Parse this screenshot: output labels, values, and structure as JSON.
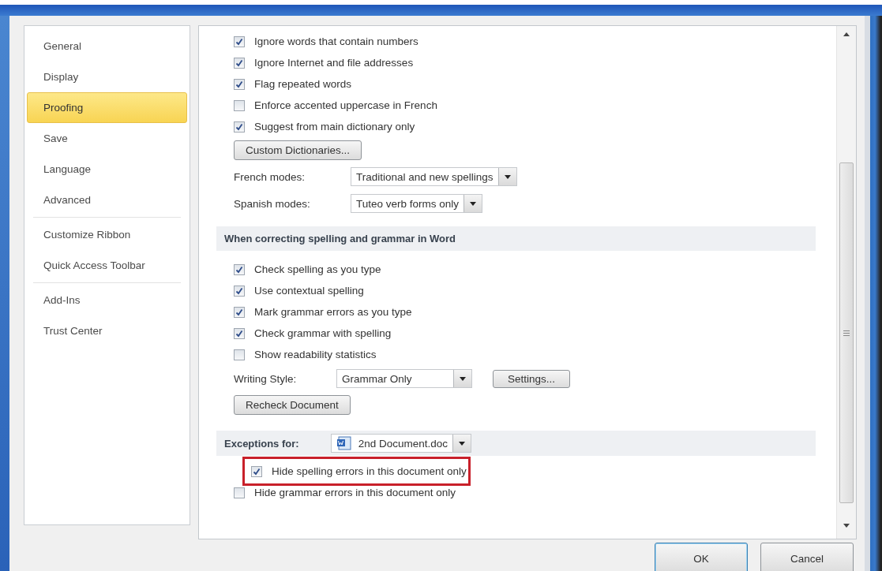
{
  "sidebar": {
    "items": [
      {
        "label": "General",
        "selected": false,
        "divider_after": false
      },
      {
        "label": "Display",
        "selected": false,
        "divider_after": false
      },
      {
        "label": "Proofing",
        "selected": true,
        "divider_after": false
      },
      {
        "label": "Save",
        "selected": false,
        "divider_after": false
      },
      {
        "label": "Language",
        "selected": false,
        "divider_after": false
      },
      {
        "label": "Advanced",
        "selected": false,
        "divider_after": true
      },
      {
        "label": "Customize Ribbon",
        "selected": false,
        "divider_after": false
      },
      {
        "label": "Quick Access Toolbar",
        "selected": false,
        "divider_after": true
      },
      {
        "label": "Add-Ins",
        "selected": false,
        "divider_after": false
      },
      {
        "label": "Trust Center",
        "selected": false,
        "divider_after": false
      }
    ]
  },
  "sections": [
    {
      "items": [
        {
          "kind": "checkbox",
          "label": "Ignore words that contain numbers",
          "checked": true,
          "highlighted": false
        },
        {
          "kind": "checkbox",
          "label": "Ignore Internet and file addresses",
          "checked": true,
          "highlighted": false
        },
        {
          "kind": "checkbox",
          "label": "Flag repeated words",
          "checked": true,
          "highlighted": false
        },
        {
          "kind": "checkbox",
          "label": "Enforce accented uppercase in French",
          "checked": false,
          "highlighted": false
        },
        {
          "kind": "checkbox",
          "label": "Suggest from main dictionary only",
          "checked": true,
          "highlighted": false
        },
        {
          "kind": "button",
          "label": "Custom Dictionaries..."
        },
        {
          "kind": "select",
          "label": "French modes:",
          "value": "Traditional and new spellings"
        },
        {
          "kind": "select",
          "label": "Spanish modes:",
          "value": "Tuteo verb forms only"
        }
      ]
    },
    {
      "header": {
        "kind": "title",
        "text": "When correcting spelling and grammar in Word"
      },
      "items": [
        {
          "kind": "checkbox",
          "label": "Check spelling as you type",
          "checked": true,
          "highlighted": false
        },
        {
          "kind": "checkbox",
          "label": "Use contextual spelling",
          "checked": true,
          "highlighted": false
        },
        {
          "kind": "checkbox",
          "label": "Mark grammar errors as you type",
          "checked": true,
          "highlighted": false
        },
        {
          "kind": "checkbox",
          "label": "Check grammar with spelling",
          "checked": true,
          "highlighted": false
        },
        {
          "kind": "checkbox",
          "label": "Show readability statistics",
          "checked": false,
          "highlighted": false
        },
        {
          "kind": "select_button",
          "label": "Writing Style:",
          "value": "Grammar Only",
          "button": "Settings..."
        },
        {
          "kind": "button",
          "label": "Recheck Document"
        }
      ]
    },
    {
      "header": {
        "kind": "file_select",
        "label": "Exceptions for:",
        "value": "2nd Document.doc"
      },
      "items": [
        {
          "kind": "checkbox",
          "label": "Hide spelling errors in this document only",
          "checked": true,
          "highlighted": true
        },
        {
          "kind": "checkbox",
          "label": "Hide grammar errors in this document only",
          "checked": false,
          "highlighted": false
        }
      ]
    }
  ],
  "buttons": [
    {
      "label": "OK",
      "default": true
    },
    {
      "label": "Cancel",
      "default": false
    }
  ]
}
